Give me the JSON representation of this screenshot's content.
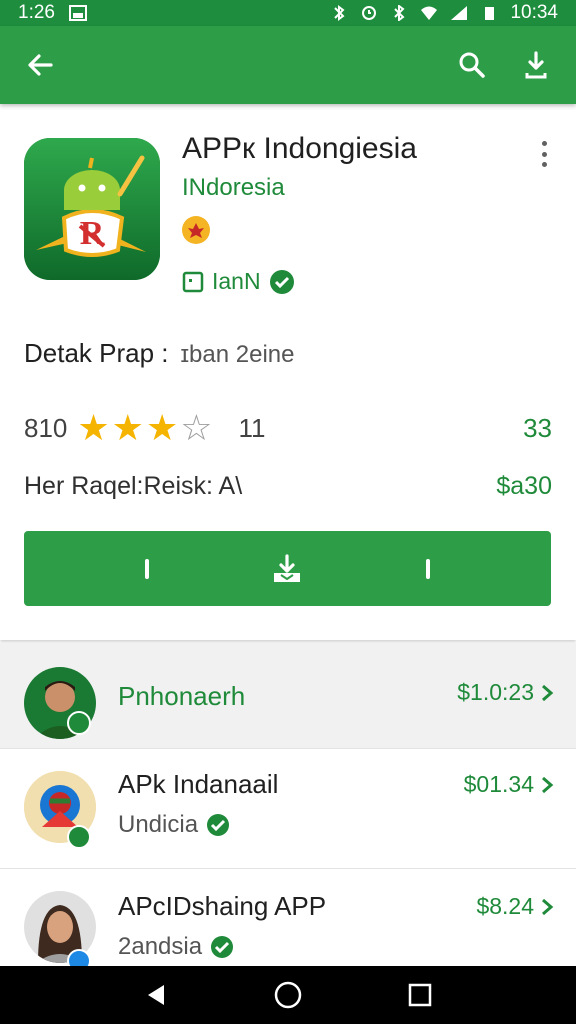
{
  "status_bar": {
    "time_left": "1:26",
    "time_right": "10:34"
  },
  "app": {
    "title": "APPк Indongiesia",
    "developer": "INdoresia",
    "verified_label": "IanN",
    "detail_label": "Detak Prap :",
    "detail_value": "ɪban 2eine",
    "rating_score": "810",
    "rating_stars": 3,
    "rating_count": "11",
    "rating_right": "33",
    "related_label": "Her Raqel:Reisk: A\\",
    "related_price": "$a30"
  },
  "list": [
    {
      "title": "Pnhonaerh",
      "subtitle": "",
      "price": "$1.0:23"
    },
    {
      "title": "APk Indanaail",
      "subtitle": "Undicia",
      "price": "$01.34"
    },
    {
      "title": "APcIDshaing APP",
      "subtitle": "2andsia",
      "price": "$8.24"
    }
  ],
  "colors": {
    "primary": "#2e9d48",
    "primary_dark": "#1e8e3e",
    "accent_star": "#f5b400",
    "text_green": "#1f8a3a"
  },
  "icons": [
    "back-arrow-icon",
    "search-icon",
    "download-icon",
    "more-vert-icon",
    "verified-check-icon",
    "chevron-right-icon"
  ]
}
